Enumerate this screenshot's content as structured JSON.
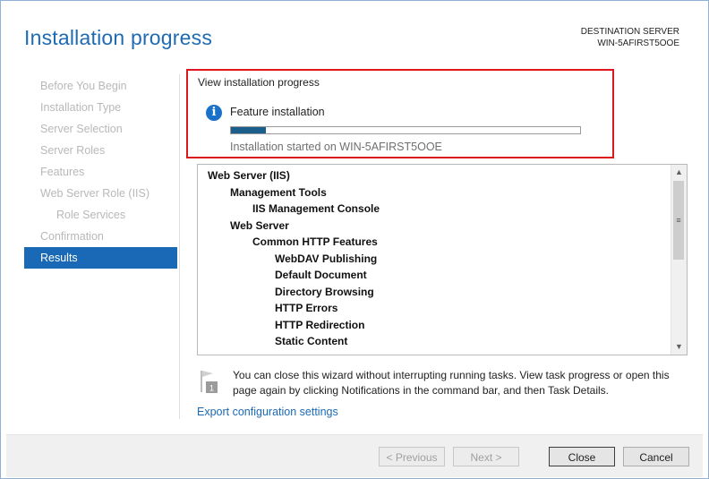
{
  "header": {
    "title": "Installation progress",
    "destination_label": "DESTINATION SERVER",
    "destination_server": "WIN-5AFIRST5OOE"
  },
  "sidebar": {
    "items": [
      {
        "label": "Before You Begin",
        "state": "disabled"
      },
      {
        "label": "Installation Type",
        "state": "disabled"
      },
      {
        "label": "Server Selection",
        "state": "disabled"
      },
      {
        "label": "Server Roles",
        "state": "disabled"
      },
      {
        "label": "Features",
        "state": "disabled"
      },
      {
        "label": "Web Server Role (IIS)",
        "state": "disabled"
      },
      {
        "label": "Role Services",
        "state": "disabled"
      },
      {
        "label": "Confirmation",
        "state": "disabled"
      },
      {
        "label": "Results",
        "state": "active"
      }
    ]
  },
  "progress": {
    "section_label": "View installation progress",
    "status_label": "Feature installation",
    "percent": 10,
    "started_text": "Installation started on WIN-5AFIRST5OOE"
  },
  "features_list": [
    {
      "label": "Web Server (IIS)",
      "level": 0
    },
    {
      "label": "Management Tools",
      "level": 1
    },
    {
      "label": "IIS Management Console",
      "level": 2
    },
    {
      "label": "Web Server",
      "level": 1
    },
    {
      "label": "Common HTTP Features",
      "level": 2
    },
    {
      "label": "WebDAV Publishing",
      "level": 3
    },
    {
      "label": "Default Document",
      "level": 3
    },
    {
      "label": "Directory Browsing",
      "level": 3
    },
    {
      "label": "HTTP Errors",
      "level": 3
    },
    {
      "label": "HTTP Redirection",
      "level": 3
    },
    {
      "label": "Static Content",
      "level": 3
    }
  ],
  "note": {
    "text": "You can close this wizard without interrupting running tasks. View task progress or open this page again by clicking Notifications in the command bar, and then Task Details.",
    "badge": "1"
  },
  "export_link": "Export configuration settings",
  "buttons": {
    "previous": "< Previous",
    "next": "Next >",
    "close": "Close",
    "cancel": "Cancel"
  },
  "colors": {
    "accent": "#1a69b6",
    "highlight_border": "#e0161d",
    "progress_fill": "#1b5e8c"
  },
  "icons": {
    "info": "info-icon",
    "flag": "flag-notification-icon",
    "scroll_up": "chevron-up-icon",
    "scroll_down": "chevron-down-icon"
  }
}
